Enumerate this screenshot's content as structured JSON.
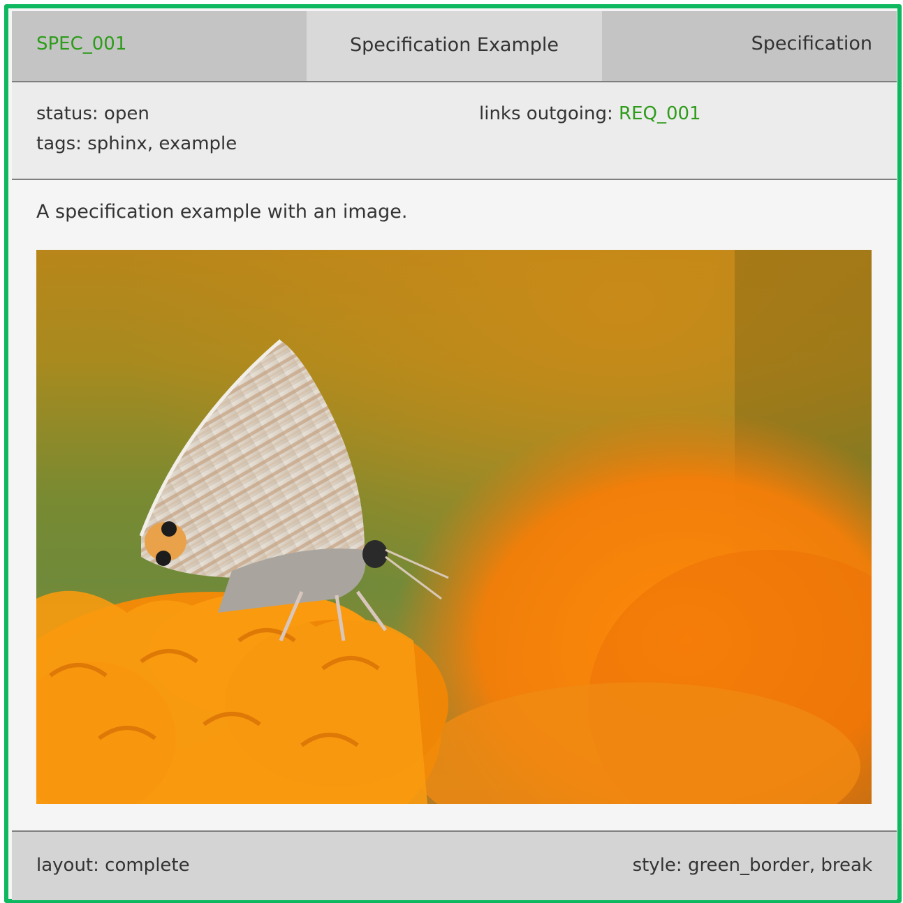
{
  "need": {
    "id": "SPEC_001",
    "title": "Specification Example",
    "type": "Specification",
    "border_color": "#0db85f",
    "link_color": "#2e9c1a"
  },
  "meta": {
    "status_label": "status: ",
    "status_value": "open",
    "tags_label": "tags: ",
    "tags_value": "sphinx, example",
    "links_label": "links outgoing: ",
    "links_value": "REQ_001"
  },
  "content": {
    "text": "A specification example with an image.",
    "image_subject": "butterfly on an orange marigold flower"
  },
  "footer": {
    "layout_label": "layout: ",
    "layout_value": "complete",
    "style_label": "style: ",
    "style_value": "green_border, break"
  }
}
